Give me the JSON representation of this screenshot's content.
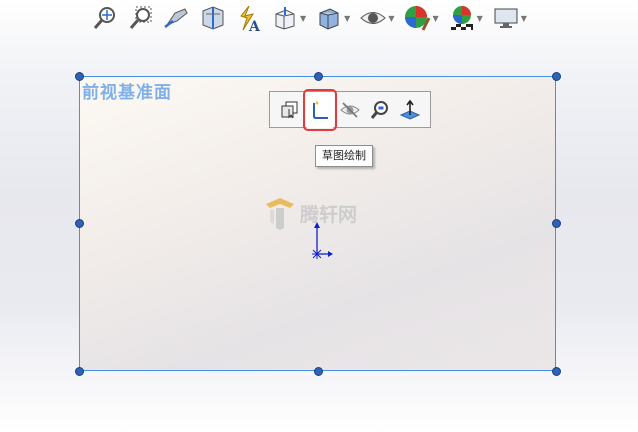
{
  "plane": {
    "label": "前视基准面"
  },
  "context_toolbar": {
    "tooltip": "草图绘制",
    "items": [
      "normal-to",
      "sketch",
      "hide",
      "zoom-to-selection",
      "normal-axis"
    ]
  },
  "watermark": {
    "text": "腾轩网"
  },
  "colors": {
    "plane_border": "#4a90e0",
    "handle": "#2d62b5",
    "highlight": "#e0393e",
    "label": "#7fb0e8"
  }
}
